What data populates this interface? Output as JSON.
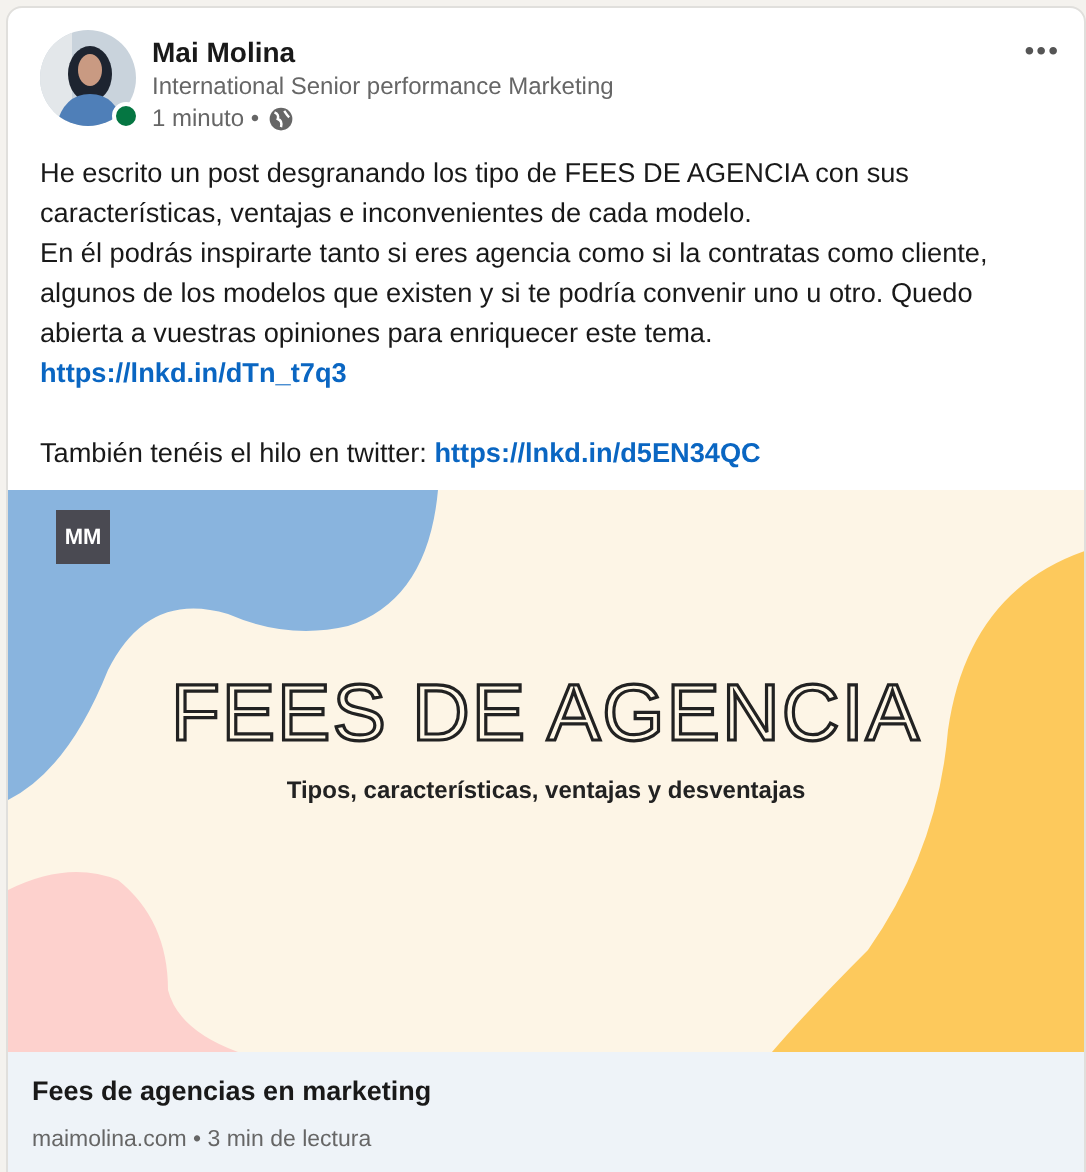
{
  "author": {
    "name": "Mai Molina",
    "headline": "International Senior performance Marketing",
    "time": "1 minuto",
    "separator": "•",
    "online": true
  },
  "menu": "•••",
  "post": [
    {
      "parts": [
        {
          "text": "He escrito un post desgranando los tipo de FEES DE AGENCIA con sus características, ventajas e inconvenientes de cada modelo."
        }
      ]
    },
    {
      "parts": [
        {
          "text": "En él podrás inspirarte tanto si eres agencia como si la contratas como cliente, algunos de los modelos que existen y si te podría convenir uno u otro. Quedo abierta a vuestras opiniones para enriquecer este tema."
        }
      ]
    },
    {
      "parts": [
        {
          "text": "https://lnkd.in/dTn_t7q3",
          "link": true
        }
      ]
    },
    {
      "parts": [
        {
          "text": "También tenéis el hilo en twitter: "
        },
        {
          "text": "https://lnkd.in/d5EN34QC",
          "link": true
        }
      ],
      "gap_before": true
    }
  ],
  "banner": {
    "logo": "MM",
    "title": "FEES DE AGENCIA",
    "subtitle": "Tipos, características, ventajas y desventajas"
  },
  "article": {
    "title": "Fees de agencias en marketing",
    "source": "maimolina.com",
    "separator": "•",
    "read_time": "3 min de lectura"
  }
}
